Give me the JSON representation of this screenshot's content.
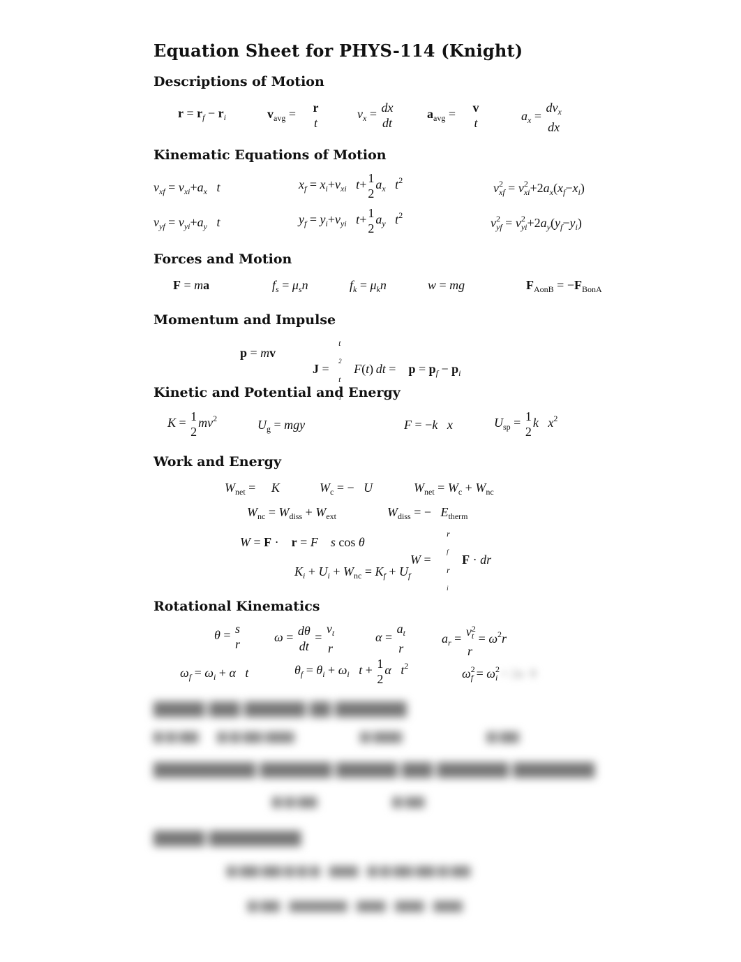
{
  "document": {
    "title": "Equation Sheet for PHYS-114 (Knight)",
    "sections": [
      {
        "heading": "Descriptions of Motion"
      },
      {
        "heading": "Kinematic Equations of Motion"
      },
      {
        "heading": "Forces and Motion"
      },
      {
        "heading": "Momentum and Impulse"
      },
      {
        "heading": "Kinetic and Potential and Energy"
      },
      {
        "heading": "Work and Energy"
      },
      {
        "heading": "Rotational Kinematics"
      }
    ],
    "blurred_preview": {
      "heading_1": "█████ ███ ██████ ██ ███████",
      "heading_2": "██████████ ███████ ██████ ███ ███████ ████████",
      "heading_3": "█████ █████████",
      "note": "content below Rotational Kinematics is blurred"
    }
  }
}
